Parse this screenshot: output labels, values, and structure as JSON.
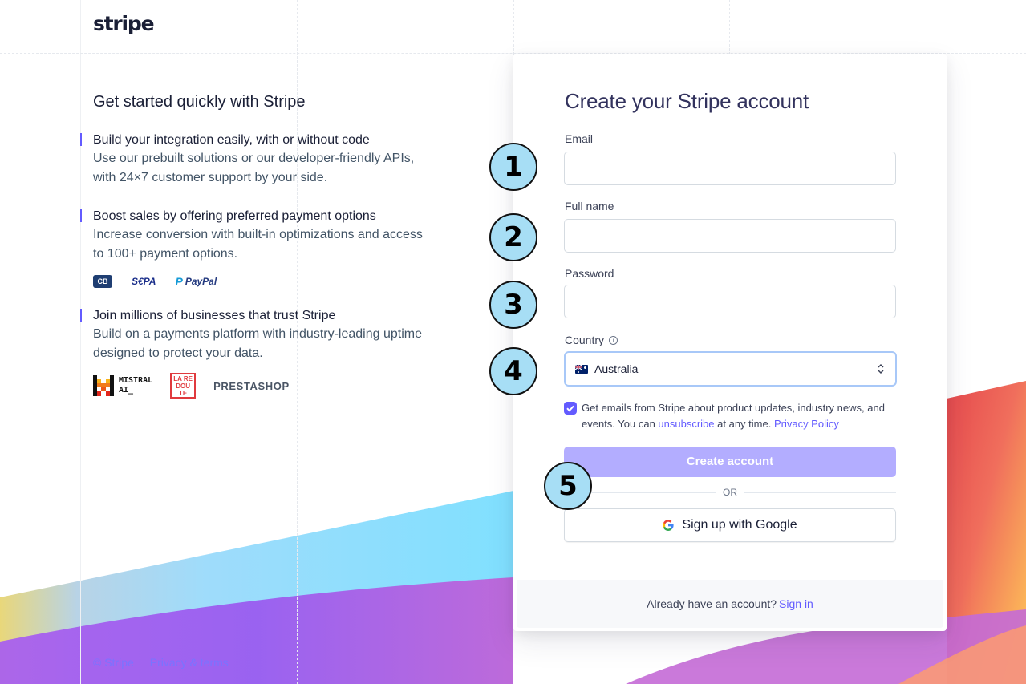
{
  "brand": {
    "logo": "stripe",
    "accent": "#635bff"
  },
  "left": {
    "heading": "Get started quickly with Stripe",
    "features": [
      {
        "title": "Build your integration easily, with or without code",
        "desc": "Use our prebuilt solutions or our developer-friendly APIs, with 24×7 customer support by your side."
      },
      {
        "title": "Boost sales by offering preferred payment options",
        "desc": "Increase conversion with built-in optimizations and access to 100+ payment options."
      },
      {
        "title": "Join millions of businesses that trust Stripe",
        "desc": "Build on a payments platform with industry-leading uptime designed to protect your data."
      }
    ],
    "payment_logos": {
      "cb": "CB",
      "sepa": "S€PA",
      "paypal": "PayPal"
    },
    "customer_logos": {
      "mistral": "MISTRAL\nAI_",
      "laredoute": "LA RE DOU TE",
      "prestashop": "PRESTASHOP"
    }
  },
  "form": {
    "title": "Create your Stripe account",
    "email_label": "Email",
    "email_value": "",
    "fullname_label": "Full name",
    "fullname_value": "",
    "password_label": "Password",
    "password_value": "",
    "country_label": "Country",
    "country_value": "Australia",
    "consent_text_1": "Get emails from Stripe about product updates, industry news, and events. You can ",
    "consent_unsubscribe": "unsubscribe",
    "consent_text_2": " at any time. ",
    "consent_privacy": "Privacy Policy",
    "consent_checked": true,
    "create_button": "Create account",
    "or_text": "OR",
    "google_button": "Sign up with Google",
    "signin_prompt": "Already have an account?",
    "signin_link": "Sign in"
  },
  "badges": [
    "1",
    "2",
    "3",
    "4",
    "5"
  ],
  "footer": {
    "copyright": "© Stripe",
    "privacy": "Privacy & terms"
  }
}
